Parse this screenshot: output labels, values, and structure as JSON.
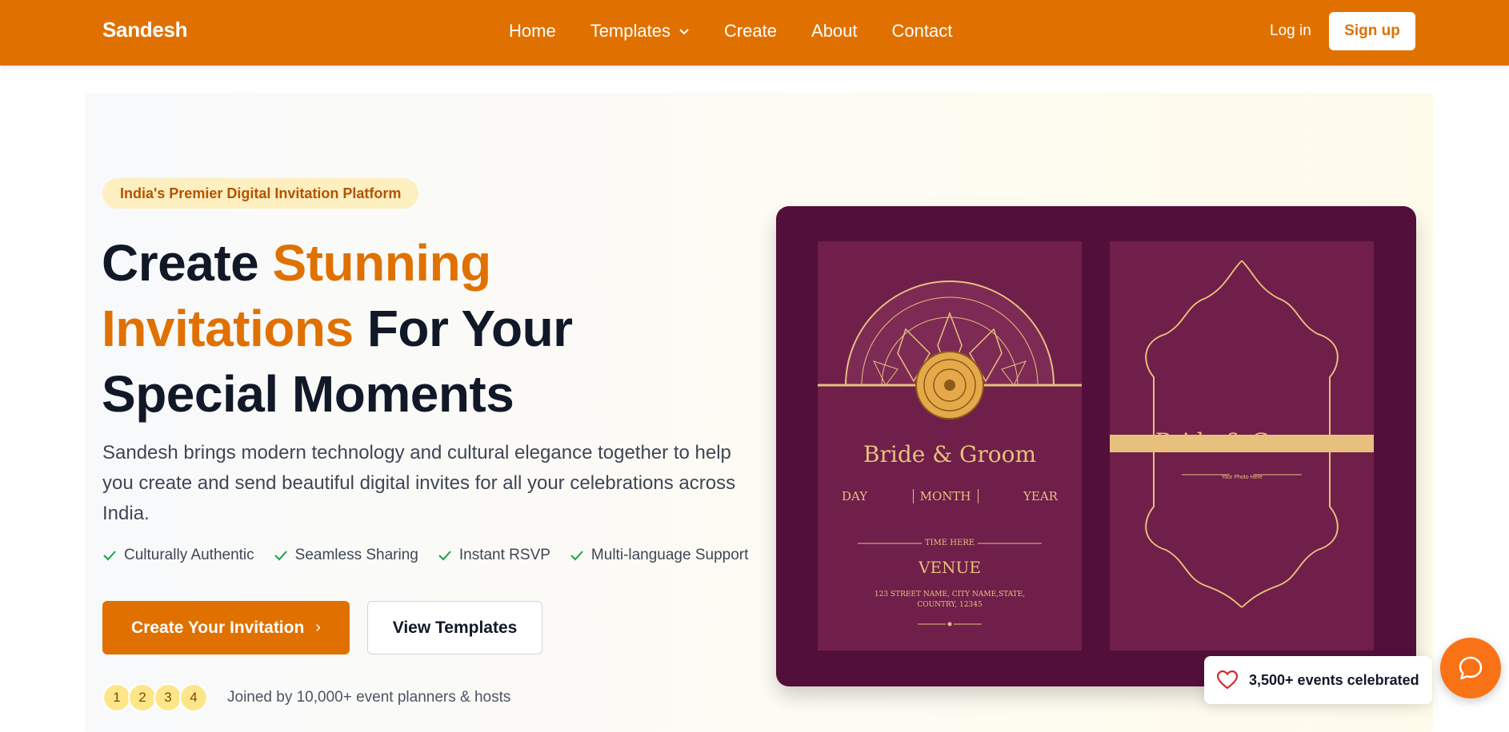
{
  "header": {
    "brand": "Sandesh",
    "nav": [
      "Home",
      "Templates",
      "Create",
      "About",
      "Contact"
    ],
    "login": "Log in",
    "signup": "Sign up"
  },
  "hero": {
    "badge": "India's Premier Digital Invitation Platform",
    "headline": {
      "part1": "Create ",
      "accent1": "Stunning",
      "accent2": "Invitations",
      "part2": " For Your",
      "part3": "Special Moments"
    },
    "description": "Sandesh brings modern technology and cultural elegance together to help you create and send beautiful digital invites for all your celebrations across India.",
    "features": [
      "Culturally Authentic",
      "Seamless Sharing",
      "Instant RSVP",
      "Multi-language Support"
    ],
    "primary_cta": "Create Your Invitation",
    "primary_cta_arrow": "›",
    "secondary_cta": "View Templates",
    "avatars": [
      "1",
      "2",
      "3",
      "4"
    ],
    "joined_text": "Joined by 10,000+ event planners & hosts"
  },
  "showcase": {
    "left_card": {
      "title": "Bride & Groom",
      "day": "DAY",
      "month": "MONTH",
      "year": "YEAR",
      "time": "TIME HERE",
      "venue": "VENUE",
      "address": "123 STREET NAME, CITY NAME,STATE, COUNTRY, 12345"
    },
    "right_card": {
      "title": "Bride & Groom",
      "photo_caption": "Your Photo Here"
    }
  },
  "stats": {
    "celebrated": "3,500+ events celebrated"
  },
  "colors": {
    "brand": "#e07100",
    "ink": "#111827",
    "invite_bg": "#520f3a",
    "gold": "#e6c07c"
  },
  "icons": {
    "templates_dropdown": "chevron-down-icon",
    "feature": "check-icon",
    "celebrated": "heart-icon",
    "chat": "chat-bubble-icon"
  }
}
